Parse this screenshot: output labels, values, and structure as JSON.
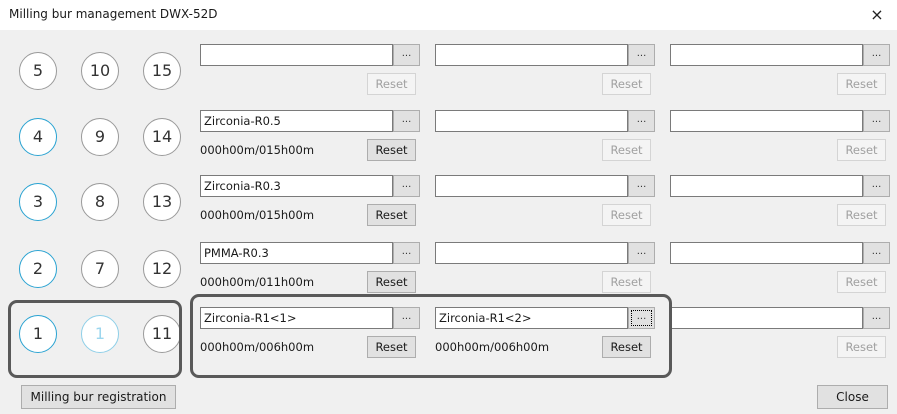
{
  "window": {
    "title": "Milling bur management DWX-52D",
    "close_symbol": "×"
  },
  "dots_label": "...",
  "grid": {
    "rows": [
      {
        "circles": [
          "5",
          "10",
          "15"
        ],
        "slots": [
          {
            "name": "",
            "time": "",
            "reset": "Reset",
            "reset_enabled": false
          },
          {
            "name": "",
            "time": "",
            "reset": "Reset",
            "reset_enabled": false
          },
          {
            "name": "",
            "time": "",
            "reset": "Reset",
            "reset_enabled": false
          }
        ]
      },
      {
        "circles": [
          "4",
          "9",
          "14"
        ],
        "slots": [
          {
            "name": "Zirconia-R0.5",
            "time": "000h00m/015h00m",
            "reset": "Reset",
            "reset_enabled": true
          },
          {
            "name": "",
            "time": "",
            "reset": "Reset",
            "reset_enabled": false
          },
          {
            "name": "",
            "time": "",
            "reset": "Reset",
            "reset_enabled": false
          }
        ]
      },
      {
        "circles": [
          "3",
          "8",
          "13"
        ],
        "slots": [
          {
            "name": "Zirconia-R0.3",
            "time": "000h00m/015h00m",
            "reset": "Reset",
            "reset_enabled": true
          },
          {
            "name": "",
            "time": "",
            "reset": "Reset",
            "reset_enabled": false
          },
          {
            "name": "",
            "time": "",
            "reset": "Reset",
            "reset_enabled": false
          }
        ]
      },
      {
        "circles": [
          "2",
          "7",
          "12"
        ],
        "slots": [
          {
            "name": "PMMA-R0.3",
            "time": "000h00m/011h00m",
            "reset": "Reset",
            "reset_enabled": true
          },
          {
            "name": "",
            "time": "",
            "reset": "Reset",
            "reset_enabled": false
          },
          {
            "name": "",
            "time": "",
            "reset": "Reset",
            "reset_enabled": false
          }
        ]
      },
      {
        "circles": [
          "1",
          "1",
          "11"
        ],
        "slots": [
          {
            "name": "Zirconia-R1<1>",
            "time": "000h00m/006h00m",
            "reset": "Reset",
            "reset_enabled": true
          },
          {
            "name": "Zirconia-R1<2>",
            "time": "000h00m/006h00m",
            "reset": "Reset",
            "reset_enabled": true
          },
          {
            "name": "",
            "time": "",
            "reset": "Reset",
            "reset_enabled": false
          }
        ]
      }
    ]
  },
  "footer": {
    "register_label": "Milling bur registration",
    "close_label": "Close"
  }
}
